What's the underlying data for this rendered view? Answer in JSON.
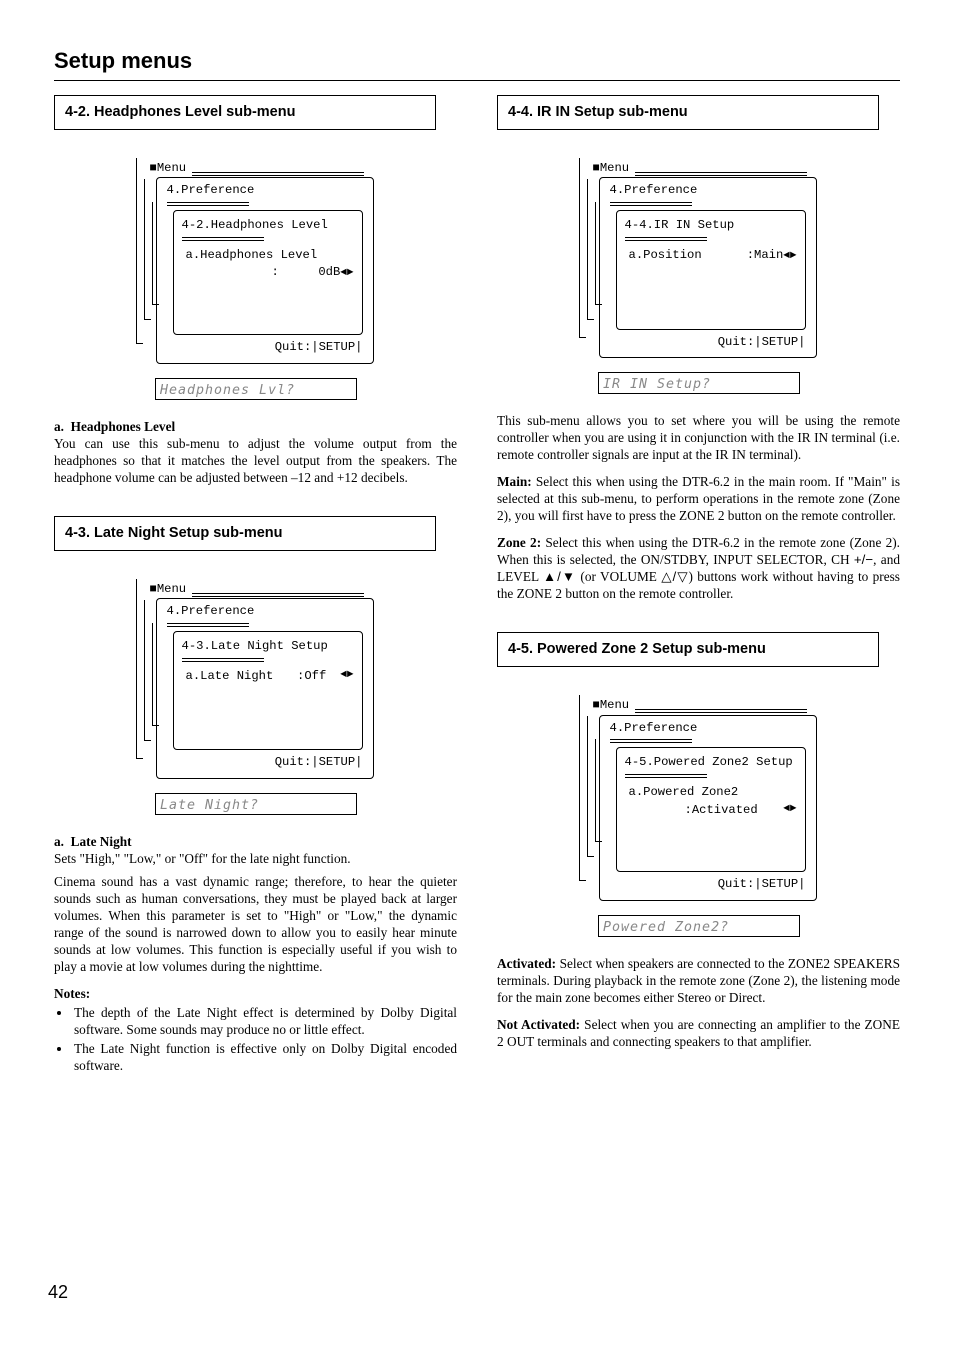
{
  "page_title": "Setup menus",
  "page_number": "42",
  "sec_42": {
    "heading": "4-2. Headphones Level sub-menu",
    "lcd": {
      "menu_label": "Menu",
      "pref": "4.Preference",
      "submenu": "4-2.Headphones Level",
      "item_a_line1": "a.Headphones Level",
      "item_a_line2_label": ":",
      "item_a_line2_val": "0dB",
      "quit": "Quit:|SETUP|"
    },
    "segdisp": "Headphones Lvl?",
    "a_label": "a.",
    "a_head": "Headphones Level",
    "a_body": "You can use this sub-menu to adjust the volume output from the headphones so that it matches the level output from the speakers. The headphone volume can be adjusted between –12 and +12 decibels."
  },
  "sec_43": {
    "heading": "4-3. Late Night Setup sub-menu",
    "lcd": {
      "menu_label": "Menu",
      "pref": "4.Preference",
      "submenu": "4-3.Late Night Setup",
      "item_a_label": "a.Late Night",
      "item_a_val": ":Off",
      "quit": "Quit:|SETUP|"
    },
    "segdisp": "Late Night?",
    "a_label": "a.",
    "a_head": "Late Night",
    "a_body1": "Sets \"High,\" \"Low,\" or \"Off\" for the late night function.",
    "a_body2": "Cinema sound has a vast dynamic range; therefore, to hear the quieter sounds such as human conversations, they must be played back at larger volumes. When this parameter is set to \"High\" or \"Low,\" the dynamic range of the sound is narrowed down to allow you to easily hear minute sounds at low volumes. This function is especially useful if you wish to play a movie at low volumes during the nighttime.",
    "notes_label": "Notes:",
    "note1": "The depth of the Late Night effect is determined by Dolby Digital software. Some sounds may produce no or little effect.",
    "note2": "The Late Night function is effective only on Dolby Digital encoded software."
  },
  "sec_44": {
    "heading": "4-4. IR IN Setup sub-menu",
    "lcd": {
      "menu_label": "Menu",
      "pref": "4.Preference",
      "submenu": "4-4.IR IN Setup",
      "item_a_label": "a.Position",
      "item_a_val": ":Main",
      "quit": "Quit:|SETUP|"
    },
    "segdisp": "IR IN Setup?",
    "intro": "This sub-menu allows you to set where you will be using the remote controller when you are using it in conjunction with the IR IN terminal (i.e. remote controller signals are input at the IR IN terminal).",
    "main_head": "Main:",
    "main_body": " Select this when using the DTR-6.2 in the main room. If \"Main\" is selected at this sub-menu, to perform operations in the remote zone (Zone 2), you will first have to press the ZONE 2 button on the remote controller.",
    "z2_head": "Zone 2:",
    "z2_body_a": " Select this when using the DTR-6.2 in the remote zone (Zone 2). When this is selected, the ON/STDBY, INPUT SELECTOR, CH ",
    "z2_body_b": ", and LEVEL ",
    "z2_body_c": " (or VOLUME ",
    "z2_body_d": ") buttons work without having to press the ZONE 2 button on the remote controller."
  },
  "sec_45": {
    "heading": "4-5. Powered Zone 2 Setup sub-menu",
    "lcd": {
      "menu_label": "Menu",
      "pref": "4.Preference",
      "submenu": "4-5.Powered Zone2 Setup",
      "item_a_line1": "a.Powered Zone2",
      "item_a_line2": ":Activated",
      "quit": "Quit:|SETUP|"
    },
    "segdisp": "Powered Zone2?",
    "act_head": "Activated:",
    "act_body": " Select when speakers are connected to the ZONE2 SPEAKERS terminals. During playback in the remote zone (Zone 2), the listening mode for the main zone becomes either Stereo or Direct.",
    "nact_head": "Not Activated:",
    "nact_body": " Select when you are connecting an amplifier to the ZONE 2 OUT terminals and connecting speakers to that amplifier."
  }
}
